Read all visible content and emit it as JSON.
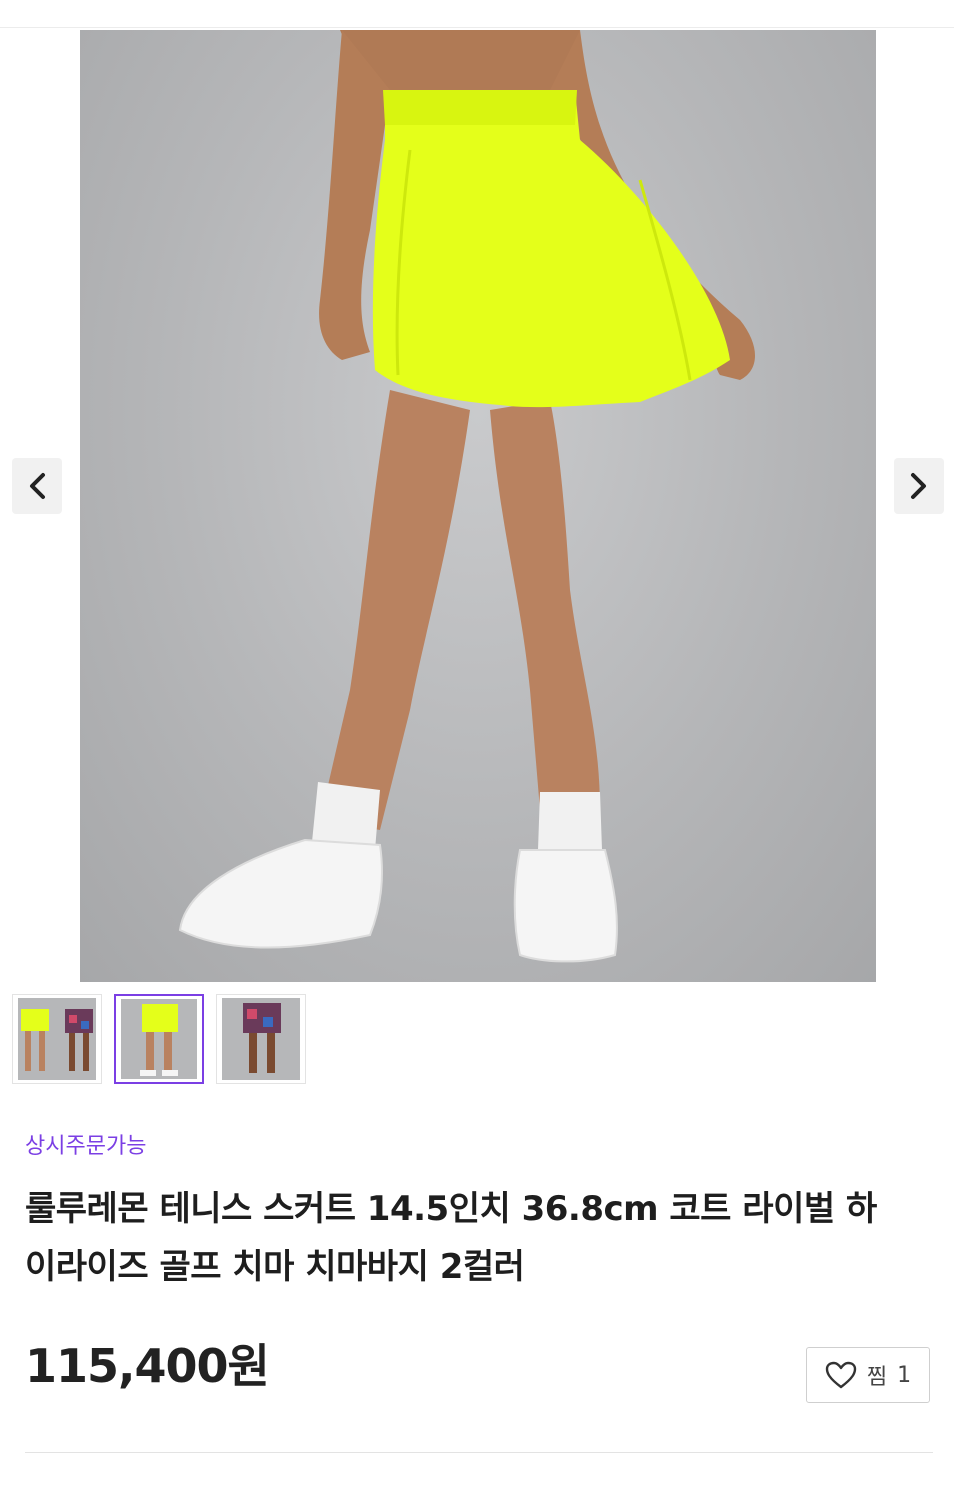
{
  "gallery": {
    "main_image_alt": "",
    "prev_icon": "chevron-left-icon",
    "next_icon": "chevron-right-icon",
    "thumbnails": [
      {
        "variant": "yellow-and-print"
      },
      {
        "variant": "yellow",
        "selected": true
      },
      {
        "variant": "print"
      }
    ]
  },
  "product": {
    "order_status": "상시주문가능",
    "title_line1": "룰루레몬 테니스 스커트 14.5인치 36.8cm 코트 라이벌 하",
    "title_line2": "이라이즈 골프 치마 치마바지 2컬러",
    "price": "115,400원"
  },
  "wishlist": {
    "icon": "heart-icon",
    "label": "찜",
    "count": "1"
  },
  "colors": {
    "accent": "#7b3fe4",
    "skirt_neon": "#e4ff1a"
  }
}
